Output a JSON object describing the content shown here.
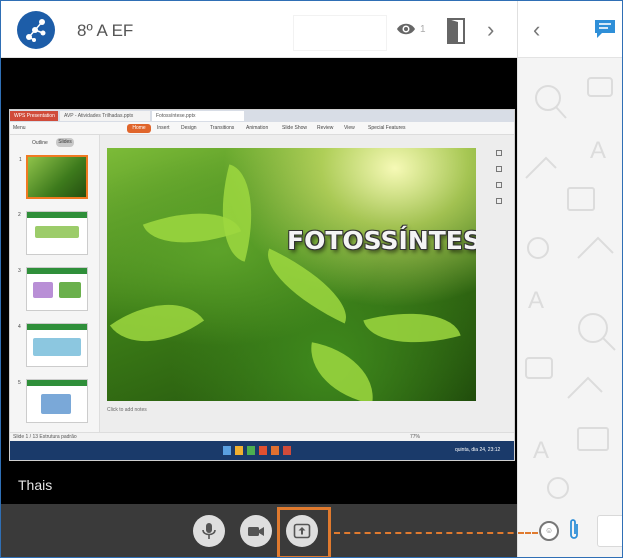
{
  "header": {
    "room_title": "8º A EF",
    "viewer_count": "1"
  },
  "screen_share": {
    "browser_tabs": [
      "WPS Presentation",
      "AVP - Atividades Trilhadas.pptx",
      "Fotossíntese.pptx"
    ],
    "ribbon_menu": [
      "Menu",
      "Home",
      "Insert",
      "Design",
      "Transitions",
      "Animation",
      "Slide Show",
      "Review",
      "View",
      "Special Features"
    ],
    "panel_tabs": {
      "outline": "Outline",
      "slides": "Slides"
    },
    "slide_title": "FOTOSSÍNTESE",
    "slide_numbers": [
      "1",
      "2",
      "3",
      "4",
      "5"
    ],
    "notes_placeholder": "Click to add notes",
    "status_left": "Slide 1 / 13    Estrutura padrão",
    "status_zoom": "77%",
    "clock": "quinta, dia 24, 23:12"
  },
  "participant": {
    "name": "Thais"
  },
  "colors": {
    "brand_blue": "#1d5da8",
    "highlight_orange": "#e07a2e",
    "control_bar": "#3a3a3a",
    "chat_blue": "#2f8fd8"
  },
  "icons": {
    "logo": "network-logo-icon",
    "viewers": "eye-icon",
    "leave": "door-icon",
    "collapse": "chevron-right-icon",
    "expand": "chevron-left-icon",
    "chat": "chat-bubble-icon",
    "mic": "microphone-icon",
    "camera": "video-camera-icon",
    "share": "share-screen-icon",
    "emoji": "emoji-icon",
    "attach": "paperclip-icon"
  }
}
